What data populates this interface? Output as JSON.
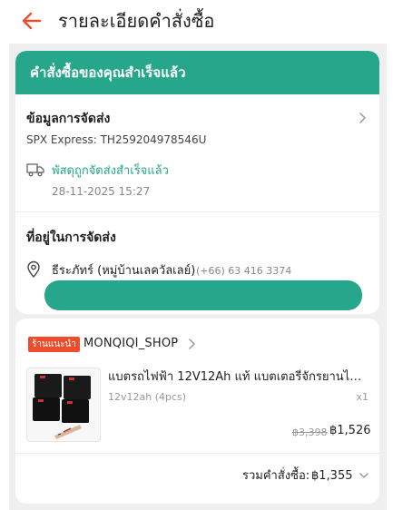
{
  "header": {
    "title": "รายละเอียดคำสั่งซื้อ",
    "back_icon": "back-arrow-icon",
    "accent_color": "#ee4d2d"
  },
  "banner": {
    "text": "คำสั่งซื้อของคุณสำเร็จแล้ว",
    "color": "#26a68a"
  },
  "shipping": {
    "title": "ข้อมูลการจัดส่ง",
    "tracking": "SPX Express: TH259204978546U",
    "status": "พัสดุถูกจัดส่งสำเร็จแล้ว",
    "status_time": "28-11-2025 15:27",
    "status_icon": "truck-icon"
  },
  "address": {
    "title": "ที่อยู่ในการจัดส่ง",
    "name": "ธีระภัทร์ (หมู่บ้านเลควัลเลย์)",
    "phone": "(+66) 63 416 3374",
    "icon": "location-pin-icon"
  },
  "shop": {
    "badge": "ร้านแนะนำ",
    "name": "MONQIQI_SHOP"
  },
  "product": {
    "title": "แบตรถไฟฟ้า 12V12Ah แท้ แบตเตอรี่จักรยานไฟฟ้า",
    "variant": "12v12ah (4pcs)",
    "qty": "x1",
    "price_old": "฿3,398",
    "price_new": "฿1,526"
  },
  "order_total": {
    "label": "รวมคำสั่งซื้อ:",
    "value": "฿1,355"
  }
}
